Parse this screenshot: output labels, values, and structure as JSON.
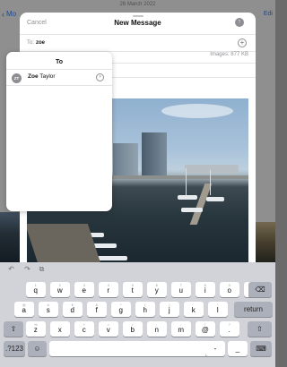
{
  "background": {
    "back_label": "Mo",
    "date_text": "26 March 2022",
    "edit_label": "Edi"
  },
  "compose": {
    "cancel_label": "Cancel",
    "title": "New Message",
    "to_label": "To:",
    "to_value": "zoe",
    "images_size": "Images: 877 KB"
  },
  "popover": {
    "title": "To",
    "contacts": [
      {
        "initials": "ZT",
        "name_bold": "Zoe",
        "name_rest": " Taylor"
      }
    ]
  },
  "keyboard": {
    "shortcuts": [
      "undo-icon",
      "redo-icon",
      "paste-icon"
    ],
    "row1": [
      {
        "k": "q",
        "h": "1"
      },
      {
        "k": "w",
        "h": "2"
      },
      {
        "k": "e",
        "h": "3"
      },
      {
        "k": "r",
        "h": "4"
      },
      {
        "k": "t",
        "h": "5"
      },
      {
        "k": "y",
        "h": "6"
      },
      {
        "k": "u",
        "h": "7"
      },
      {
        "k": "i",
        "h": "8"
      },
      {
        "k": "o",
        "h": "9"
      },
      {
        "k": "p",
        "h": "0"
      }
    ],
    "row2": [
      {
        "k": "a",
        "h": "@"
      },
      {
        "k": "s",
        "h": "#"
      },
      {
        "k": "d",
        "h": "€"
      },
      {
        "k": "f",
        "h": "&"
      },
      {
        "k": "g",
        "h": "*"
      },
      {
        "k": "h",
        "h": "("
      },
      {
        "k": "j",
        "h": ")"
      },
      {
        "k": "k",
        "h": "'"
      },
      {
        "k": "l",
        "h": "\""
      }
    ],
    "row3": [
      {
        "k": "z",
        "h": "%"
      },
      {
        "k": "x",
        "h": "-"
      },
      {
        "k": "c",
        "h": "+"
      },
      {
        "k": "v",
        "h": "="
      },
      {
        "k": "b",
        "h": "/"
      },
      {
        "k": "n",
        "h": ";"
      },
      {
        "k": "m",
        "h": ":"
      },
      {
        "k": "@",
        "h": "!"
      },
      {
        "k": ".",
        "h": "?"
      }
    ],
    "numbers_label": ".?123",
    "space_label": "",
    "return_label": "return",
    "dash_label": "-",
    "underscore_label": "_"
  }
}
